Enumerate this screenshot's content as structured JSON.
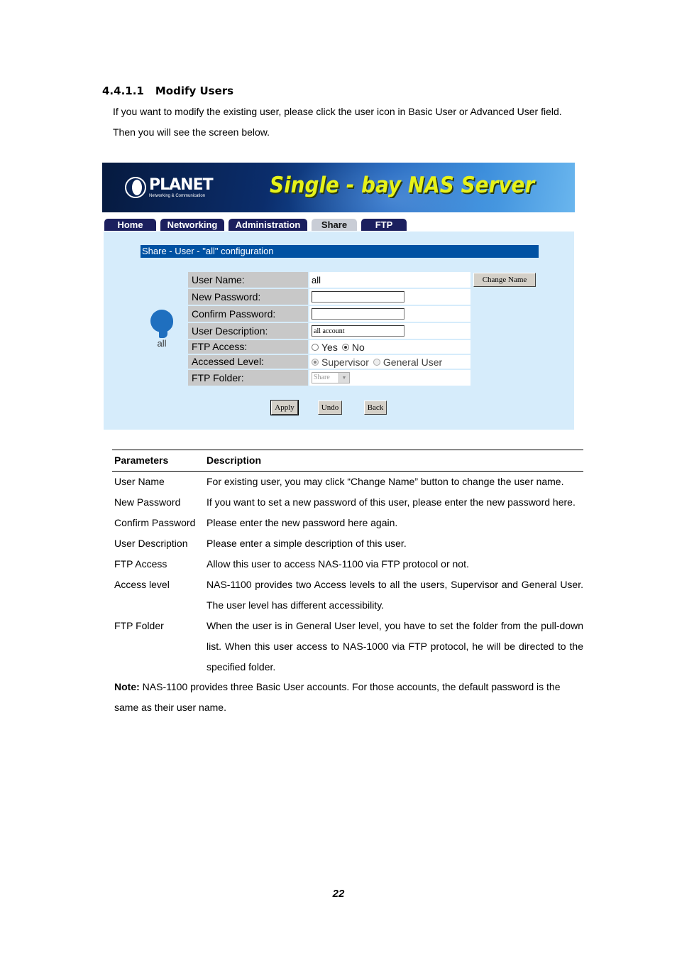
{
  "doc": {
    "section_number": "4.4.1.1",
    "section_title": "Modify Users",
    "intro_line1": "If you want to modify the existing user, please click the user icon in Basic User or Advanced User field.",
    "intro_line2": "Then you will see the screen below.",
    "page_number": "22"
  },
  "screenshot": {
    "brand": "PLANET",
    "brand_tagline": "Networking & Communication",
    "product_title": "Single - bay NAS Server",
    "tabs": [
      {
        "label": "Home",
        "active": false
      },
      {
        "label": "Networking",
        "active": false
      },
      {
        "label": "Administration",
        "active": false
      },
      {
        "label": "Share",
        "active": true
      },
      {
        "label": "FTP",
        "active": false
      }
    ],
    "config_title": "Share - User - \"all\" configuration",
    "user_icon_label": "all",
    "form": {
      "user_name_label": "User Name:",
      "user_name_value": "all",
      "change_name_button": "Change Name",
      "new_password_label": "New Password:",
      "new_password_value": "",
      "confirm_password_label": "Confirm Password:",
      "confirm_password_value": "",
      "user_description_label": "User Description:",
      "user_description_value": "all account",
      "ftp_access_label": "FTP Access:",
      "ftp_access_options": [
        "Yes",
        "No"
      ],
      "ftp_access_selected": "No",
      "access_level_label": "Accessed Level:",
      "access_level_options": [
        "Supervisor",
        "General User"
      ],
      "access_level_selected": "Supervisor",
      "ftp_folder_label": "FTP Folder:",
      "ftp_folder_value": "Share"
    },
    "buttons": {
      "apply": "Apply",
      "undo": "Undo",
      "back": "Back"
    },
    "colors": {
      "tab_bg": "#1b1f5e",
      "tab_active_bg": "#c9cdd6",
      "panel_bg": "#d6ecfb",
      "config_bar": "#0052a3",
      "product_title": "#e6f21a"
    }
  },
  "param_table": {
    "headers": [
      "Parameters",
      "Description"
    ],
    "rows": [
      {
        "param": "User Name",
        "desc": "For existing user, you may click “Change Name” button to change the user name."
      },
      {
        "param": "New Password",
        "desc": "If you want to set a new password of this user, please enter the new password here."
      },
      {
        "param": "Confirm Password",
        "desc": "Please enter the new password here again."
      },
      {
        "param": "User Description",
        "desc": "Please enter a simple description of this user."
      },
      {
        "param": "FTP Access",
        "desc": "Allow this user to access NAS-1100 via FTP protocol or not."
      },
      {
        "param": "Access level",
        "desc": "NAS-1100 provides two Access levels to all the users, Supervisor and General User. The user level has different accessibility."
      },
      {
        "param": "FTP Folder",
        "desc": "When the user is in General User level, you have to set the folder from the pull-down list. When this user access to NAS-1000 via FTP protocol, he will be directed to the specified folder."
      }
    ]
  },
  "note": {
    "label": "Note:",
    "text": " NAS-1100 provides three Basic User accounts. For those accounts, the default password is the same as their user name."
  }
}
